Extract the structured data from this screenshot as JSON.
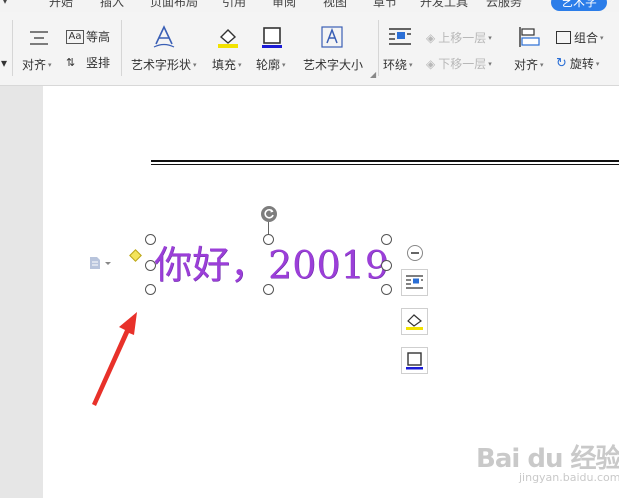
{
  "tabs": [
    "开始",
    "插入",
    "页面布局",
    "引用",
    "审阅",
    "视图",
    "章节",
    "开发工具",
    "云服务",
    "艺术字"
  ],
  "toolbar": {
    "prev_caret": "▾",
    "align_left": "对齐",
    "same_height": "等高",
    "vertical": "竖排",
    "art_shape": "艺术字形状",
    "fill": "填充",
    "outline": "轮廓",
    "art_size": "艺术字大小",
    "wrap": "环绕",
    "move_up": "上移一层",
    "move_down": "下移一层",
    "align_right": "对齐",
    "group": "组合",
    "rotate": "旋转"
  },
  "document": {
    "art_text": "你好，20019"
  },
  "watermark": {
    "main": "Bai du 经验",
    "sub": "jingyan.baidu.com"
  },
  "colors": {
    "accent": "#2b7de9",
    "art_text": "#9b3fd8",
    "arrow": "#e8312a"
  }
}
